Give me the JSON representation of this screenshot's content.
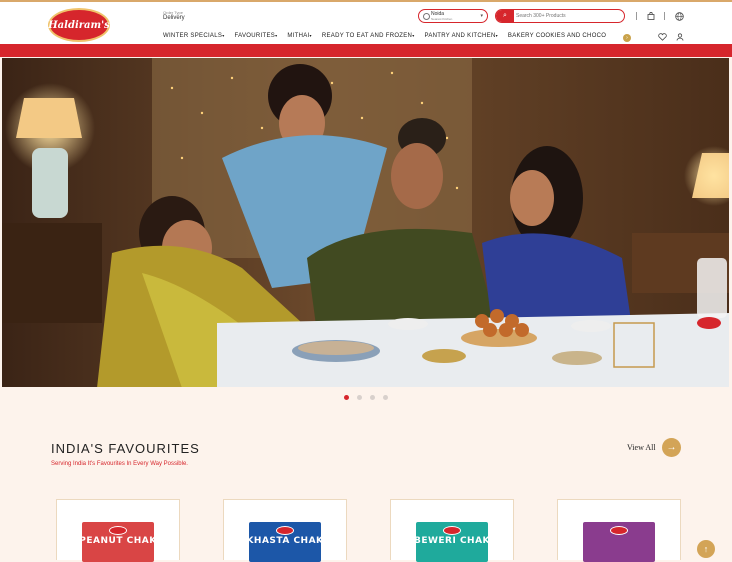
{
  "header": {
    "logo_text": "Haldiram's",
    "order_type_label": "Order Type",
    "order_type_value": "Delivery",
    "location": {
      "city": "Noida",
      "sub": "Nearest Kitchen"
    },
    "search_placeholder": "Search 300+ Products"
  },
  "nav": {
    "items": [
      "WINTER SPECIALS",
      "FAVOURITES",
      "MITHAI",
      "READY TO EAT AND FROZEN",
      "PANTRY AND KITCHEN",
      "BAKERY COOKIES AND CHOCO"
    ],
    "caret": "▾",
    "overflow_badge": "›"
  },
  "icons": {
    "search": "search-icon",
    "cart": "bag-icon",
    "globe": "globe-icon",
    "wishlist": "heart-icon",
    "user": "user-icon",
    "location": "pin-icon"
  },
  "carousel": {
    "slides": 4,
    "active": 0
  },
  "favourites": {
    "title": "INDIA'S FAVOURITES",
    "subtitle": "Serving India It's Favourites In Every Way Possible.",
    "view_all": "View All",
    "arrow": "→",
    "products": [
      {
        "name": "PEANUT CHAK",
        "color": "#d94545"
      },
      {
        "name": "KHASTA CHAK",
        "color": "#1c57a8"
      },
      {
        "name": "BEWERI CHAK",
        "color": "#1faa9c"
      },
      {
        "name": "",
        "color": "#8a3c8e"
      }
    ]
  },
  "colors": {
    "brand_red": "#d6262c",
    "gold": "#d3a457",
    "background": "#fdf3ec"
  },
  "scroll_top": "↑"
}
